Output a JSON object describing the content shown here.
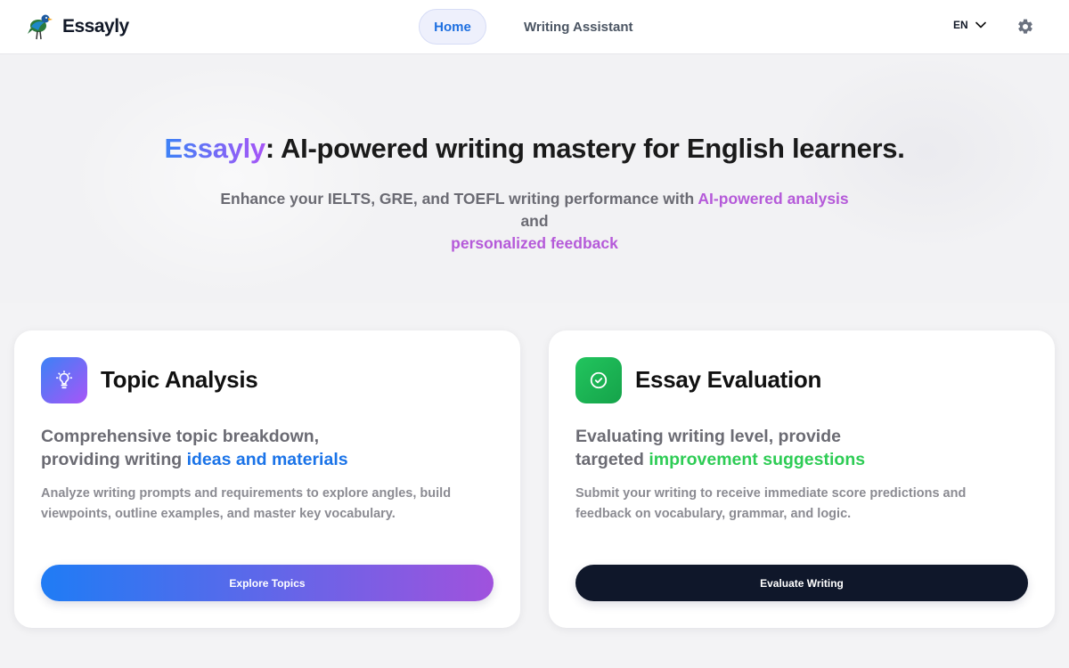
{
  "brand": {
    "name": "Essayly",
    "logo_icon": "bird-logo-icon"
  },
  "nav": {
    "tabs": [
      {
        "label": "Home",
        "active": true
      },
      {
        "label": "Writing Assistant",
        "active": false
      }
    ],
    "language": "EN",
    "settings_icon": "gear-icon"
  },
  "hero": {
    "title_brand": "Essayly",
    "title_rest": ": AI-powered writing mastery for English learners.",
    "subtitle_part1": "Enhance your IELTS, GRE, and TOEFL writing performance with ",
    "subtitle_highlight1": "AI-powered analysis",
    "subtitle_part2": " and ",
    "subtitle_highlight2": "personalized feedback"
  },
  "cards": [
    {
      "icon": "lightbulb-icon",
      "title": "Topic Analysis",
      "headline_line1": "Comprehensive topic breakdown,",
      "headline_line2_prefix": "providing writing ",
      "headline_highlight": "ideas and materials",
      "description": "Analyze writing prompts and requirements to explore angles, build viewpoints, outline examples, and master key vocabulary.",
      "button_label": "Explore Topics"
    },
    {
      "icon": "check-circle-icon",
      "title": "Essay Evaluation",
      "headline_line1": "Evaluating writing level, provide",
      "headline_line2_prefix": "targeted ",
      "headline_highlight": "improvement suggestions",
      "description": "Submit your writing to receive immediate score predictions and feedback on vocabulary, grammar, and logic.",
      "button_label": "Evaluate Writing"
    }
  ],
  "colors": {
    "accent_blue": "#1a73e8",
    "accent_purple": "#b55ad9",
    "accent_green": "#2ecc55",
    "dark_button": "#0f172a"
  }
}
